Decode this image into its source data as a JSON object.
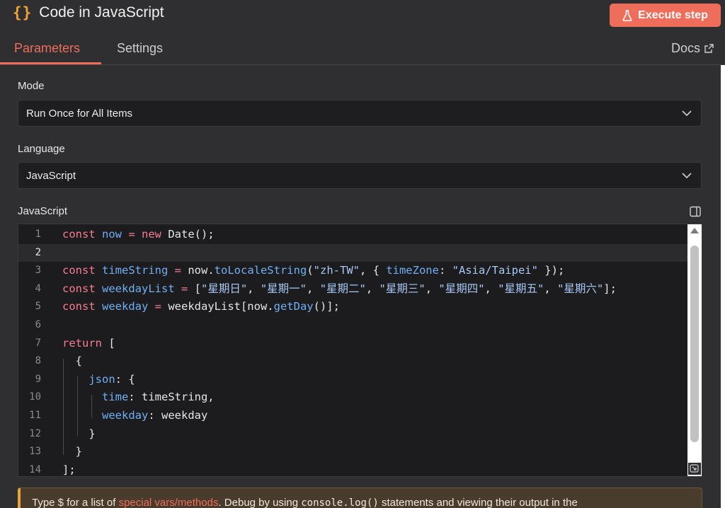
{
  "header": {
    "icon": "curly-braces-icon",
    "braces": "{}",
    "title": "Code in JavaScript",
    "execute_label": "Execute step",
    "accent": "#ee6d5b"
  },
  "tabs": {
    "parameters": "Parameters",
    "settings": "Settings",
    "docs": "Docs"
  },
  "form": {
    "mode_label": "Mode",
    "mode_value": "Run Once for All Items",
    "language_label": "Language",
    "language_value": "JavaScript",
    "code_label": "JavaScript"
  },
  "editor": {
    "active_line": 2,
    "lines": [
      {
        "n": "1",
        "tokens": [
          [
            "kw",
            "const "
          ],
          [
            "var",
            "now"
          ],
          [
            "op",
            " = "
          ],
          [
            "kw",
            "new "
          ],
          [
            "plain",
            "Date();"
          ]
        ]
      },
      {
        "n": "2",
        "tokens": []
      },
      {
        "n": "3",
        "tokens": [
          [
            "kw",
            "const "
          ],
          [
            "var",
            "timeString"
          ],
          [
            "op",
            " = "
          ],
          [
            "plain",
            "now."
          ],
          [
            "var",
            "toLocaleString"
          ],
          [
            "plain",
            "("
          ],
          [
            "str",
            "\"zh-TW\""
          ],
          [
            "plain",
            ", { "
          ],
          [
            "var",
            "timeZone"
          ],
          [
            "plain",
            ": "
          ],
          [
            "str",
            "\"Asia/Taipei\""
          ],
          [
            "plain",
            " });"
          ]
        ]
      },
      {
        "n": "4",
        "tokens": [
          [
            "kw",
            "const "
          ],
          [
            "var",
            "weekdayList"
          ],
          [
            "op",
            " = "
          ],
          [
            "plain",
            "["
          ],
          [
            "str",
            "\"星期日\""
          ],
          [
            "plain",
            ", "
          ],
          [
            "str",
            "\"星期一\""
          ],
          [
            "plain",
            ", "
          ],
          [
            "str",
            "\"星期二\""
          ],
          [
            "plain",
            ", "
          ],
          [
            "str",
            "\"星期三\""
          ],
          [
            "plain",
            ", "
          ],
          [
            "str",
            "\"星期四\""
          ],
          [
            "plain",
            ", "
          ],
          [
            "str",
            "\"星期五\""
          ],
          [
            "plain",
            ", "
          ],
          [
            "str",
            "\"星期六\""
          ],
          [
            "plain",
            "];"
          ]
        ]
      },
      {
        "n": "5",
        "tokens": [
          [
            "kw",
            "const "
          ],
          [
            "var",
            "weekday"
          ],
          [
            "op",
            " = "
          ],
          [
            "plain",
            "weekdayList[now."
          ],
          [
            "var",
            "getDay"
          ],
          [
            "plain",
            "()];"
          ]
        ]
      },
      {
        "n": "6",
        "tokens": []
      },
      {
        "n": "7",
        "tokens": [
          [
            "kw",
            "return "
          ],
          [
            "plain",
            "["
          ]
        ]
      },
      {
        "n": "8",
        "tokens": [
          [
            "plain",
            "  {"
          ]
        ]
      },
      {
        "n": "9",
        "tokens": [
          [
            "plain",
            "    "
          ],
          [
            "var",
            "json"
          ],
          [
            "plain",
            ": {"
          ]
        ]
      },
      {
        "n": "10",
        "tokens": [
          [
            "plain",
            "      "
          ],
          [
            "var",
            "time"
          ],
          [
            "plain",
            ": timeString,"
          ]
        ]
      },
      {
        "n": "11",
        "tokens": [
          [
            "plain",
            "      "
          ],
          [
            "var",
            "weekday"
          ],
          [
            "plain",
            ": weekday"
          ]
        ]
      },
      {
        "n": "12",
        "tokens": [
          [
            "plain",
            "    }"
          ]
        ]
      },
      {
        "n": "13",
        "tokens": [
          [
            "plain",
            "  }"
          ]
        ]
      },
      {
        "n": "14",
        "tokens": [
          [
            "plain",
            "];"
          ]
        ]
      }
    ]
  },
  "notice": {
    "prefix": "Type $ for a list of ",
    "link": "special vars/methods",
    "middle": ". Debug by using ",
    "code": "console.log()",
    "suffix": " statements and viewing their output in the"
  }
}
